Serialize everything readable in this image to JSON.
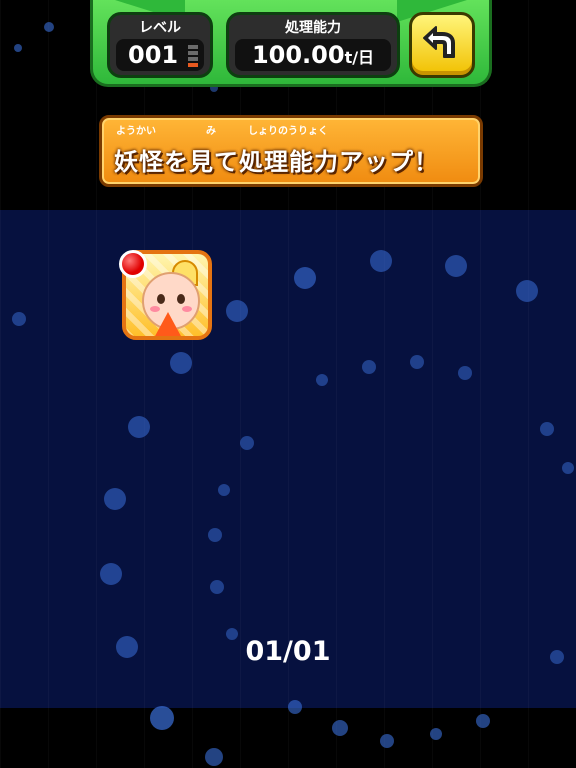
{
  "header": {
    "level_label": "レベル",
    "level_value": "001",
    "processing_label": "処理能力",
    "processing_value": "100.00",
    "processing_unit": "t/日"
  },
  "banner": {
    "text": "妖怪を見て処理能力アップ！",
    "ruby_youkai": "ようかい",
    "ruby_mi": "み",
    "ruby_shorinouryoku": "しょりのうりょく"
  },
  "icons": {
    "back": "back-arrow-icon",
    "new_badge": "red-dot-icon"
  },
  "pagination": {
    "text": "01/01"
  },
  "colors": {
    "panel_green": "#2fb83a",
    "back_button_yellow": "#f1c000",
    "banner_orange": "#f08b10",
    "background_navy": "#06113f"
  }
}
